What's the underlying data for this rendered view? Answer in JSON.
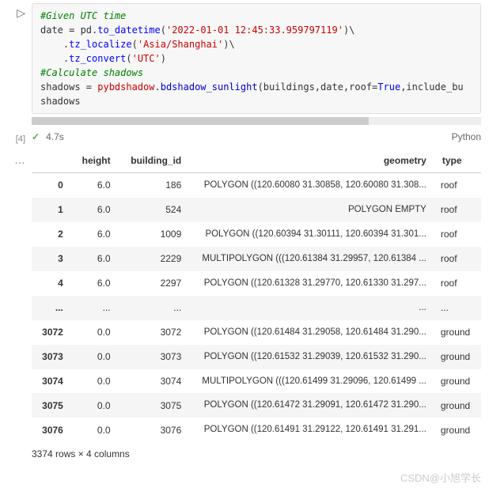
{
  "code": {
    "comment1": "#Given UTC time",
    "line2_var": "date = pd.",
    "line2_func": "to_datetime",
    "line2_open": "(",
    "line2_str": "'2022-01-01 12:45:33.959797119'",
    "line2_end": ")\\",
    "line3_pre": "    .",
    "line3_func": "tz_localize",
    "line3_open": "(",
    "line3_str": "'Asia/Shanghai'",
    "line3_end": ")\\",
    "line4_pre": "    .",
    "line4_func": "tz_convert",
    "line4_open": "(",
    "line4_str": "'UTC'",
    "line4_end": ")",
    "comment2": "#Calculate shadows",
    "line6_a": "shadows = ",
    "line6_mod": "pybdshadow",
    "line6_dot": ".",
    "line6_fn": "bdshadow_sunlight",
    "line6_args1": "(buildings,date,roof=",
    "line6_true": "True",
    "line6_args2": ",include_bu",
    "line7": "shadows"
  },
  "status": {
    "exec_count": "[4]",
    "time": "4.7s",
    "language": "Python"
  },
  "table": {
    "headers": [
      "",
      "height",
      "building_id",
      "geometry",
      "type"
    ],
    "rows": [
      {
        "idx": "0",
        "height": "6.0",
        "bid": "186",
        "geom": "POLYGON ((120.60080 31.30858, 120.60080 31.308...",
        "type": "roof"
      },
      {
        "idx": "1",
        "height": "6.0",
        "bid": "524",
        "geom": "POLYGON EMPTY",
        "type": "roof"
      },
      {
        "idx": "2",
        "height": "6.0",
        "bid": "1009",
        "geom": "POLYGON ((120.60394 31.30111, 120.60394 31.301...",
        "type": "roof"
      },
      {
        "idx": "3",
        "height": "6.0",
        "bid": "2229",
        "geom": "MULTIPOLYGON (((120.61384 31.29957, 120.61384 ...",
        "type": "roof"
      },
      {
        "idx": "4",
        "height": "6.0",
        "bid": "2297",
        "geom": "POLYGON ((120.61328 31.29770, 120.61330 31.297...",
        "type": "roof"
      },
      {
        "idx": "...",
        "height": "...",
        "bid": "...",
        "geom": "...",
        "type": "..."
      },
      {
        "idx": "3072",
        "height": "0.0",
        "bid": "3072",
        "geom": "POLYGON ((120.61484 31.29058, 120.61484 31.290...",
        "type": "ground"
      },
      {
        "idx": "3073",
        "height": "0.0",
        "bid": "3073",
        "geom": "POLYGON ((120.61532 31.29039, 120.61532 31.290...",
        "type": "ground"
      },
      {
        "idx": "3074",
        "height": "0.0",
        "bid": "3074",
        "geom": "MULTIPOLYGON (((120.61499 31.29096, 120.61499 ...",
        "type": "ground"
      },
      {
        "idx": "3075",
        "height": "0.0",
        "bid": "3075",
        "geom": "POLYGON ((120.61472 31.29091, 120.61472 31.290...",
        "type": "ground"
      },
      {
        "idx": "3076",
        "height": "0.0",
        "bid": "3076",
        "geom": "POLYGON ((120.61491 31.29122, 120.61491 31.291...",
        "type": "ground"
      }
    ],
    "summary": "3374 rows × 4 columns"
  },
  "watermark": "CSDN@小旭学长"
}
